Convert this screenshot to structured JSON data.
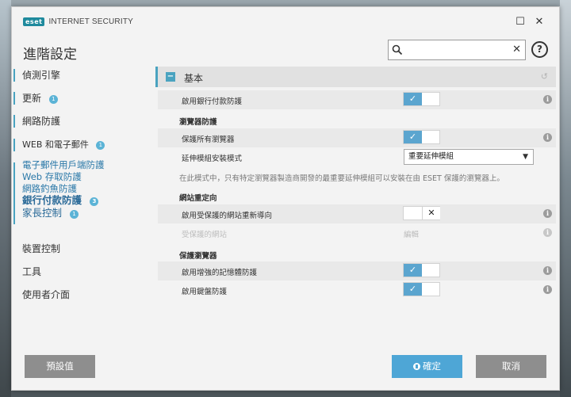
{
  "app": {
    "logo": "eset",
    "title": "INTERNET SECURITY",
    "window_controls": {
      "maximize": "☐",
      "close": "✕"
    }
  },
  "page_title": "進階設定",
  "search": {
    "value": "",
    "placeholder": "",
    "clear_label": "✕"
  },
  "help_label": "?",
  "sidebar": {
    "items": [
      {
        "label": "偵測引擎"
      },
      {
        "label": "更新",
        "badge": "1"
      },
      {
        "label": "網路防護"
      },
      {
        "label": "WEB 和電子郵件",
        "badge": "1"
      }
    ],
    "sub_items": [
      {
        "label": "電子郵件用戶端防護"
      },
      {
        "label": "Web 存取防護"
      },
      {
        "label": "網路釣魚防護"
      },
      {
        "label": "銀行付款防護",
        "badge": "3"
      },
      {
        "label": "家長控制",
        "badge": "1"
      }
    ],
    "bottom_items": [
      {
        "label": "裝置控制"
      },
      {
        "label": "工具"
      },
      {
        "label": "使用者介面"
      }
    ]
  },
  "section": {
    "collapse_symbol": "−",
    "title": "基本",
    "reset_symbol": "↺"
  },
  "settings": {
    "enable_banking": {
      "label": "啟用銀行付款防護",
      "enabled": true
    },
    "group_browser": "瀏覽器防護",
    "protect_all_browsers": {
      "label": "保護所有瀏覽器",
      "enabled": true
    },
    "extension_mode": {
      "label": "延伸模組安裝模式",
      "value": "重要延伸模組"
    },
    "note": "在此模式中，只有特定瀏覽器製造商開發的最重要延伸模組可以安裝在由 ESET 保護的瀏覽器上。",
    "group_redirect": "網站重定向",
    "enable_redirect": {
      "label": "啟用受保護的網站重新導向",
      "enabled": false
    },
    "protected_sites": {
      "label": "受保護的網站",
      "value": "編輯"
    },
    "group_secure_browser": "保護瀏覽器",
    "enhanced_memory": {
      "label": "啟用增強的記憶體防護",
      "enabled": true
    },
    "keyboard_protection": {
      "label": "啟用鍵盤防護",
      "enabled": true
    }
  },
  "toggle_symbols": {
    "on": "✓",
    "off": "✕"
  },
  "footer": {
    "default_label": "預設值",
    "ok_label": "確定",
    "cancel_label": "取消"
  },
  "colors": {
    "accent": "#4aa3c0",
    "toggle_on": "#5ba5cf",
    "ok_button": "#4ea6d6",
    "button_gray": "#8e8e8e"
  }
}
